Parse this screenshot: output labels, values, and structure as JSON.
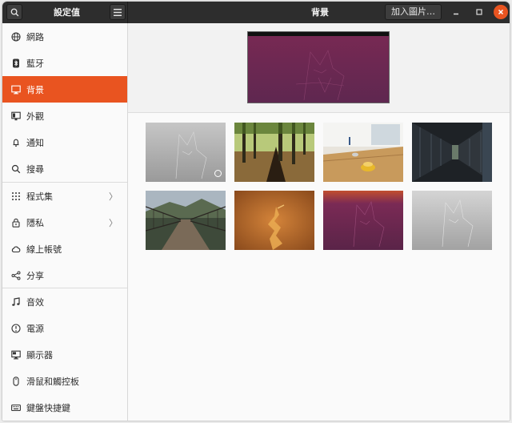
{
  "header": {
    "sidebar_title": "設定值",
    "page_title": "背景",
    "add_button_label": "加入圖片…"
  },
  "sidebar": {
    "items": [
      {
        "label": "網路",
        "icon": "network-icon"
      },
      {
        "label": "藍牙",
        "icon": "bluetooth-icon"
      },
      {
        "label": "背景",
        "icon": "background-icon",
        "active": true
      },
      {
        "label": "外觀",
        "icon": "appearance-icon"
      },
      {
        "label": "通知",
        "icon": "bell-icon"
      },
      {
        "label": "搜尋",
        "icon": "search-icon"
      },
      {
        "label": "程式集",
        "icon": "apps-grid-icon",
        "submenu": true
      },
      {
        "label": "隱私",
        "icon": "lock-icon",
        "submenu": true
      },
      {
        "label": "線上帳號",
        "icon": "cloud-icon"
      },
      {
        "label": "分享",
        "icon": "share-icon"
      },
      {
        "label": "音效",
        "icon": "music-note-icon"
      },
      {
        "label": "電源",
        "icon": "power-icon"
      },
      {
        "label": "顯示器",
        "icon": "display-icon"
      },
      {
        "label": "滑鼠和觸控板",
        "icon": "mouse-icon"
      },
      {
        "label": "鍵盤快捷鍵",
        "icon": "keyboard-icon"
      }
    ]
  },
  "colors": {
    "accent": "#e95420",
    "headerbar": "#2d2d2d"
  },
  "wallpapers": [
    {
      "name": "grey-warty-final-ubuntu",
      "selected": true
    },
    {
      "name": "forest-sunlight"
    },
    {
      "name": "table-bowling"
    },
    {
      "name": "subway-platform"
    },
    {
      "name": "wooden-bridge"
    },
    {
      "name": "orange-sculpture"
    },
    {
      "name": "warty-final-ubuntu-purple"
    },
    {
      "name": "grey-warty-light"
    }
  ]
}
